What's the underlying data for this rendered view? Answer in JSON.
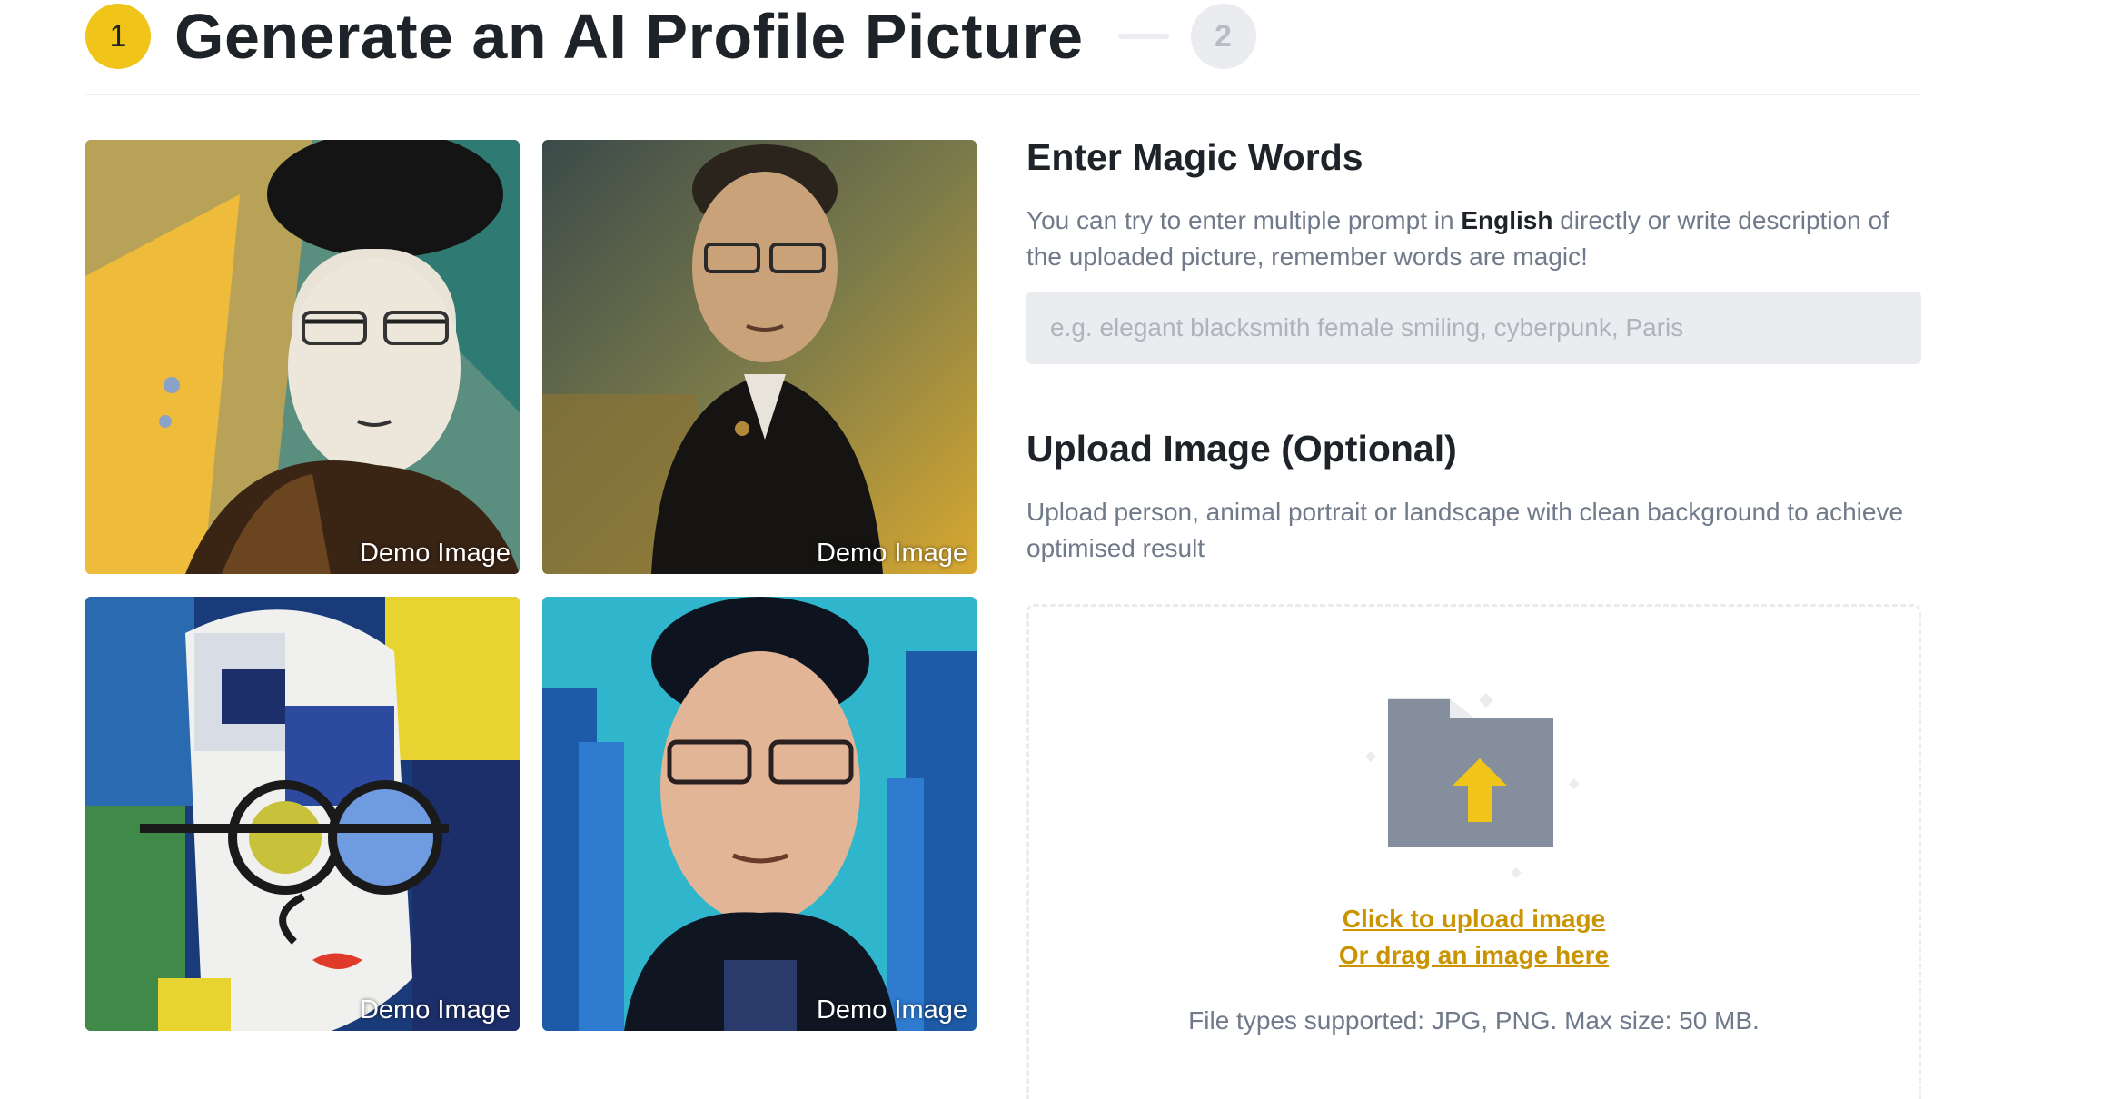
{
  "header": {
    "step1_number": "1",
    "title": "Generate an AI Profile Picture",
    "step2_number": "2"
  },
  "demo_images": [
    {
      "label": "Demo Image",
      "style": "sketch-portrait"
    },
    {
      "label": "Demo Image",
      "style": "oil-painting-portrait"
    },
    {
      "label": "Demo Image",
      "style": "cubist-portrait"
    },
    {
      "label": "Demo Image",
      "style": "cyberpunk-portrait"
    }
  ],
  "magic_words": {
    "title": "Enter Magic Words",
    "desc_before": "You can try to enter multiple prompt in ",
    "desc_emphasis": "English",
    "desc_after": " directly or write description of the uploaded picture, remember words are magic!",
    "placeholder": "e.g. elegant blacksmith female smiling, cyberpunk, Paris"
  },
  "upload": {
    "title": "Upload Image (Optional)",
    "desc": "Upload person, animal portrait or landscape with clean background to achieve optimised result",
    "link_click": "Click to upload image",
    "link_drag": "Or drag an image here",
    "file_types": "File types supported: JPG, PNG. Max size: 50 MB.",
    "icon": "folder-upload-icon"
  },
  "colors": {
    "accent": "#f0c419",
    "link": "#c99400",
    "text_primary": "#1e2329",
    "text_secondary": "#707a8a",
    "input_bg": "#eaecef"
  }
}
